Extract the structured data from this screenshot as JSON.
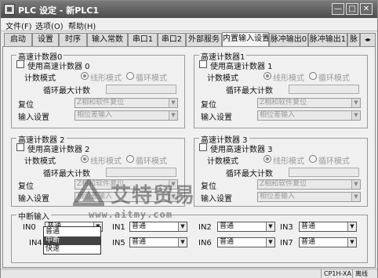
{
  "window": {
    "title": "PLC 设定 - 新PLC1",
    "minimize": "—",
    "maximize": "□",
    "close": "✕"
  },
  "menu": [
    "文件(F)",
    "选项(O)",
    "帮助(H)"
  ],
  "tabs": [
    "启动",
    "设置",
    "时序",
    "输入常数",
    "串口1",
    "串口2",
    "外部服务",
    "内置输入设置",
    "脉冲输出0",
    "脉冲输出1",
    "脉"
  ],
  "tab_scroll": "◂▸",
  "counters": [
    {
      "title": "高速计数器0",
      "enable": "使用高速计数器 0",
      "mode_label": "计数模式",
      "mode_options": [
        "线形模式",
        "循环模式"
      ],
      "max_label": "循环最大计数",
      "max_value": "0",
      "reset_label": "复位",
      "reset_value": "Z相和软件复位",
      "input_label": "输入设置",
      "input_value": "相位差输入"
    },
    {
      "title": "高速计数器1",
      "enable": "使用高速计数器 1",
      "mode_label": "计数模式",
      "mode_options": [
        "线形模式",
        "循环模式"
      ],
      "max_label": "循环最大计数",
      "max_value": "0",
      "reset_label": "复位",
      "reset_value": "Z相和软件复位",
      "input_label": "输入设置",
      "input_value": "相位差输入"
    },
    {
      "title": "高速计数器 2",
      "enable": "使用高速计数器 2",
      "mode_label": "计数模式",
      "mode_options": [
        "线形模式",
        "循环模式"
      ],
      "max_label": "循环最大计数",
      "max_value": "0",
      "reset_label": "复位",
      "reset_value": "Z相和软件复位",
      "input_label": "输入设置",
      "input_value": "相位差输入"
    },
    {
      "title": "高速计数器 3",
      "enable": "使用高速计数器 3",
      "mode_label": "计数模式",
      "mode_options": [
        "线形模式",
        "循环模式"
      ],
      "max_label": "循环最大计数",
      "max_value": "0",
      "reset_label": "复位",
      "reset_value": "Z相和软件复位",
      "input_label": "输入设置",
      "input_value": "相位差输入"
    }
  ],
  "interrupt": {
    "title": "中断输入",
    "inputs": [
      {
        "label": "IN0",
        "value": "普通"
      },
      {
        "label": "IN1",
        "value": "普通"
      },
      {
        "label": "IN2",
        "value": "普通"
      },
      {
        "label": "IN3",
        "value": "普通"
      },
      {
        "label": "IN4",
        "value": "普通"
      },
      {
        "label": "IN5",
        "value": "普通"
      },
      {
        "label": "IN6",
        "value": "普通"
      },
      {
        "label": "IN7",
        "value": "普通"
      }
    ],
    "dropdown_options": [
      "普通",
      "中断",
      "快速"
    ],
    "dropdown_highlight": "中断"
  },
  "status": {
    "model": "CP1H-XA",
    "state": "离线"
  },
  "watermark": {
    "title": "艾特贸易",
    "url": "www.aitmy.com"
  }
}
